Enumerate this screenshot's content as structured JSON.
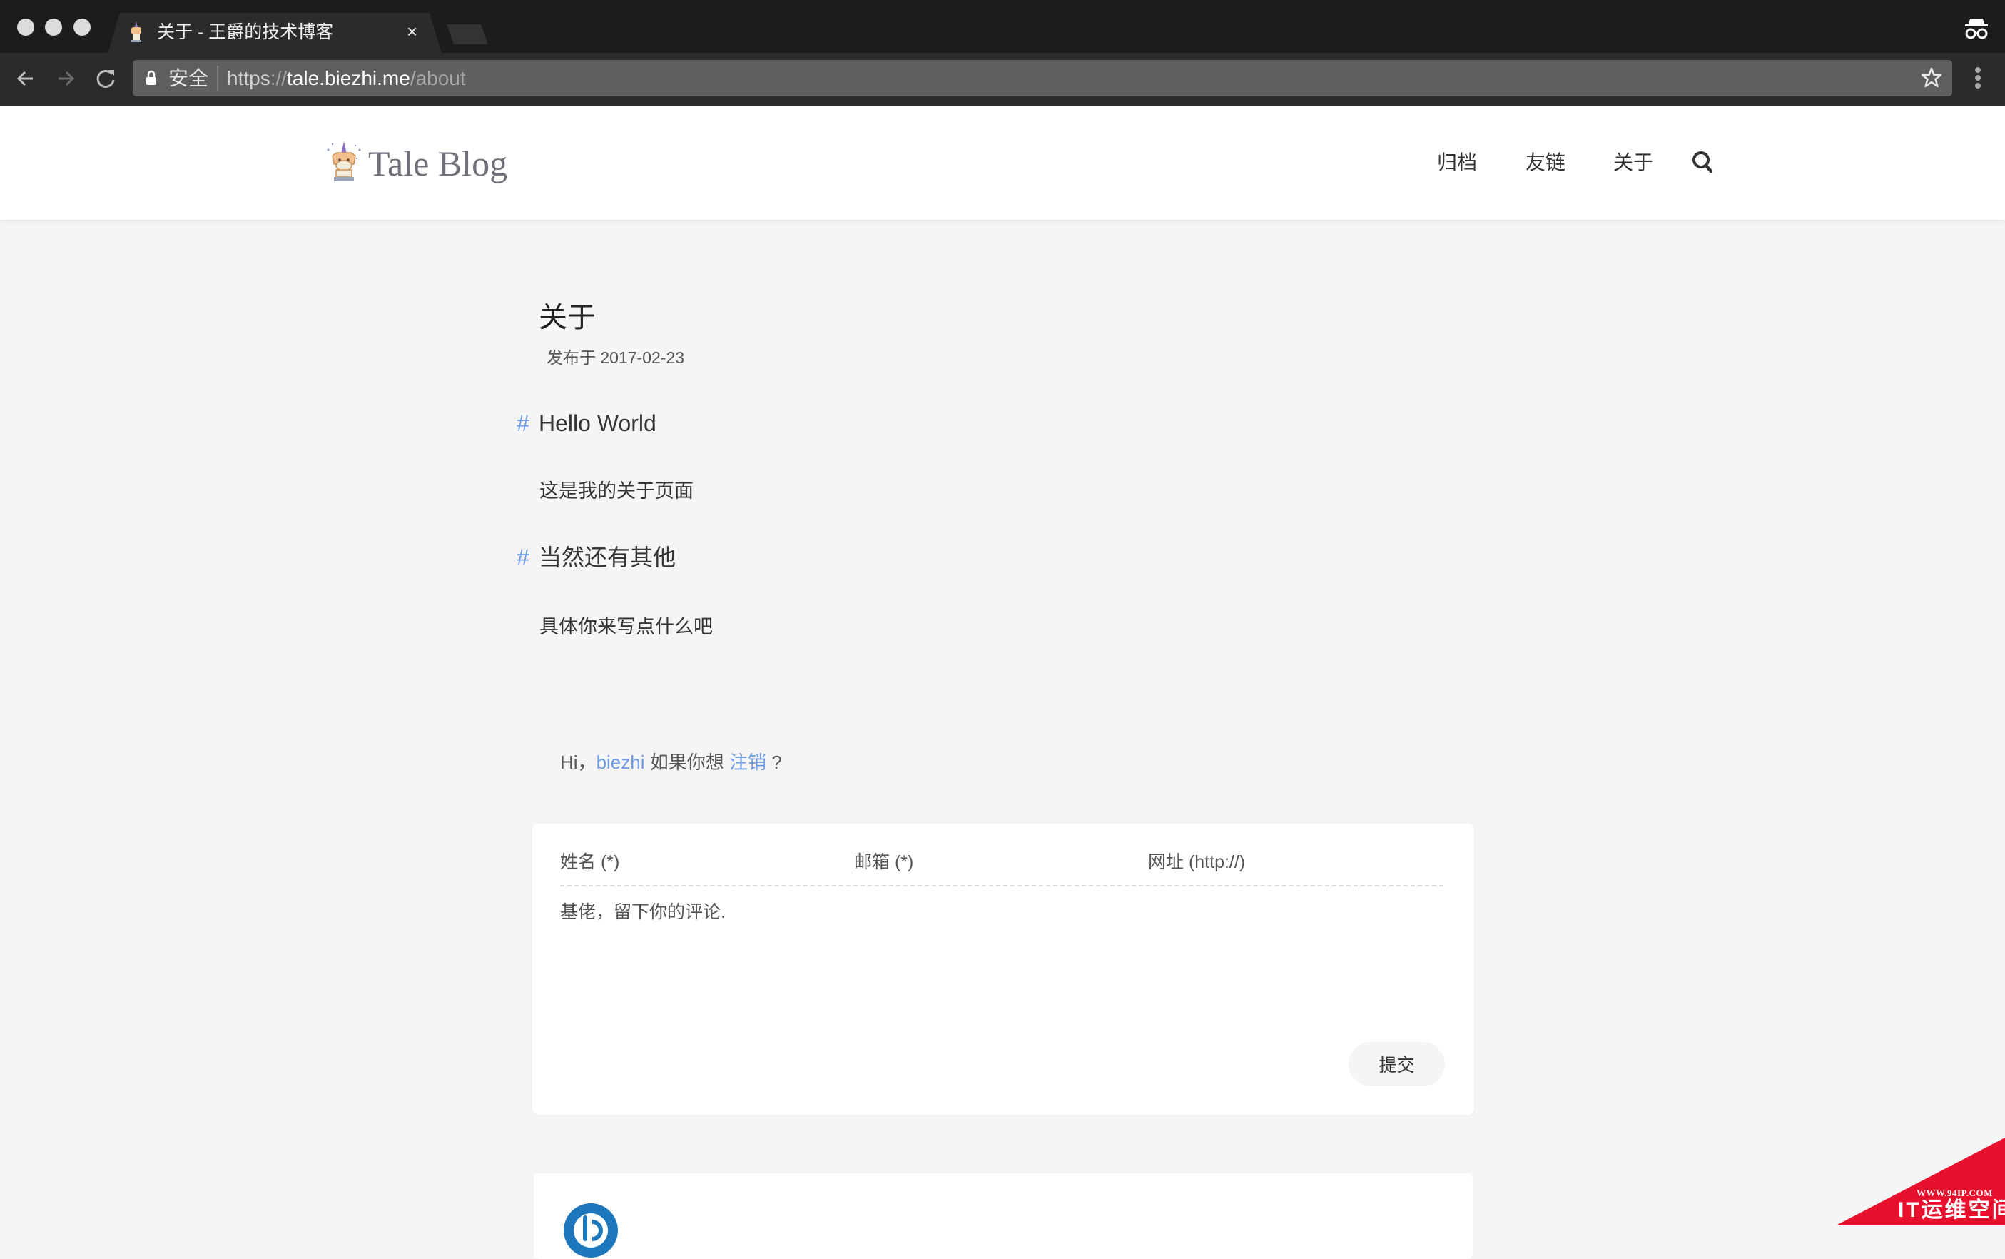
{
  "browser": {
    "tab_title": "关于 - 王爵的技术博客",
    "tab_close": "×",
    "security_label": "安全",
    "url": {
      "scheme": "https",
      "separator": "://",
      "host": "tale.biezhi.me",
      "path": "/about"
    },
    "icons": {
      "back": "arrow-left-icon",
      "forward": "arrow-right-icon",
      "reload": "reload-icon",
      "lock": "lock-icon",
      "bookmark": "star-icon",
      "menu": "kebab-menu-icon",
      "incognito": "incognito-icon"
    }
  },
  "site": {
    "logo_text": "Tale Blog",
    "nav": [
      {
        "label": "归档"
      },
      {
        "label": "友链"
      },
      {
        "label": "关于"
      }
    ],
    "search_icon": "search-icon"
  },
  "post": {
    "title": "关于",
    "meta": "发布于 2017-02-23",
    "sections": [
      {
        "hash": "#",
        "heading": "Hello World",
        "body": "这是我的关于页面"
      },
      {
        "hash": "#",
        "heading": "当然还有其他",
        "body": "具体你来写点什么吧"
      }
    ]
  },
  "comment": {
    "greeting_prefix": "Hi，",
    "username": "biezhi",
    "greeting_middle": " 如果你想 ",
    "logout_label": "注销",
    "greeting_suffix": " ?",
    "fields": {
      "name_placeholder": "姓名 (*)",
      "email_placeholder": "邮箱 (*)",
      "url_placeholder": "网址 (http://)",
      "text_placeholder": "基佬，留下你的评论."
    },
    "submit_label": "提交"
  },
  "watermark": {
    "url": "WWW.94IP.COM",
    "name": "IT运维空间",
    "color": "#e8112d"
  },
  "colors": {
    "accent": "#6e9be4",
    "page_bg": "#f5f5f5",
    "tabbar_bg": "#1c1c1c",
    "toolbar_bg": "#2b2b2b"
  }
}
